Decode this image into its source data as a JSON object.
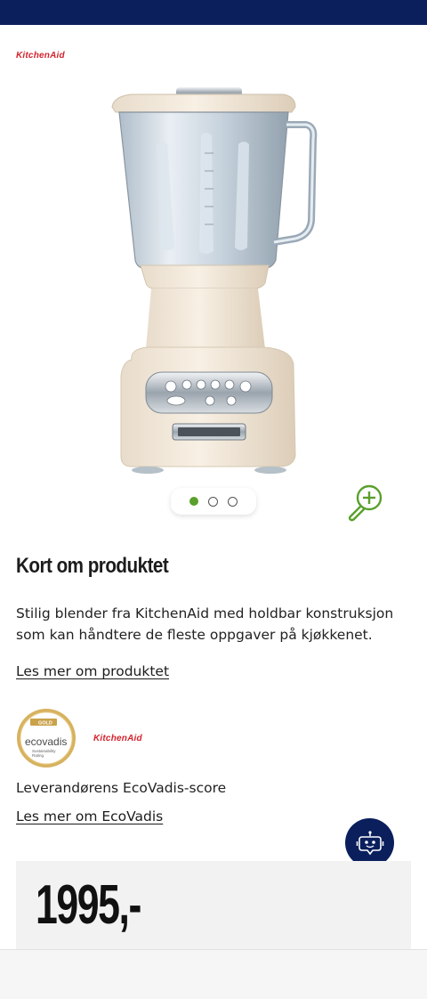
{
  "brand": {
    "name": "KitchenAid",
    "color": "#d3232f"
  },
  "header": {
    "bar_color": "#0a1f5c"
  },
  "gallery": {
    "image_icon": "blender-product-image",
    "slide_count": 3,
    "active_slide": 1,
    "zoom_icon": "zoom-in-icon"
  },
  "product": {
    "section_title": "Kort om produktet",
    "description": "Stilig blender fra KitchenAid med holdbar konstruksjon som kan håndtere de fleste oppgaver på kjøkkenet.",
    "read_more_label": "Les mer om produktet"
  },
  "ecovadis": {
    "badge_tier": "GOLD",
    "badge_name": "ecovadis",
    "badge_subtitle_1": "Sustainability",
    "badge_subtitle_2": "Rating",
    "score_label": "Leverandørens EcoVadis-score",
    "read_more_label": "Les mer om EcoVadis"
  },
  "chat": {
    "icon": "chat-bot-icon"
  },
  "price": {
    "value": "1995,-"
  },
  "colors": {
    "accent_green": "#5aa02c",
    "navy": "#0a1f5c",
    "gold": "#c9a24a"
  }
}
